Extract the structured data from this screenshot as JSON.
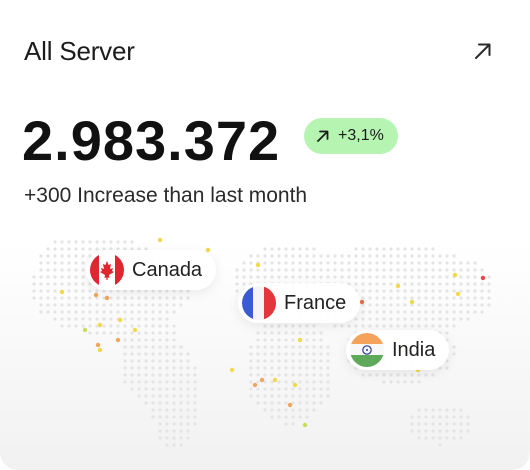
{
  "card": {
    "title": "All Server",
    "total": "2.983.372",
    "change_badge": "+3,1%",
    "subtitle": "+300 Increase than last month",
    "accent_green": "#b6f5b1",
    "open_icon": "arrow-up-right-icon"
  },
  "locations": [
    {
      "label": "Canada",
      "flag_icon": "canada-flag-icon"
    },
    {
      "label": "France",
      "flag_icon": "france-flag-icon"
    },
    {
      "label": "India",
      "flag_icon": "india-flag-icon"
    }
  ]
}
